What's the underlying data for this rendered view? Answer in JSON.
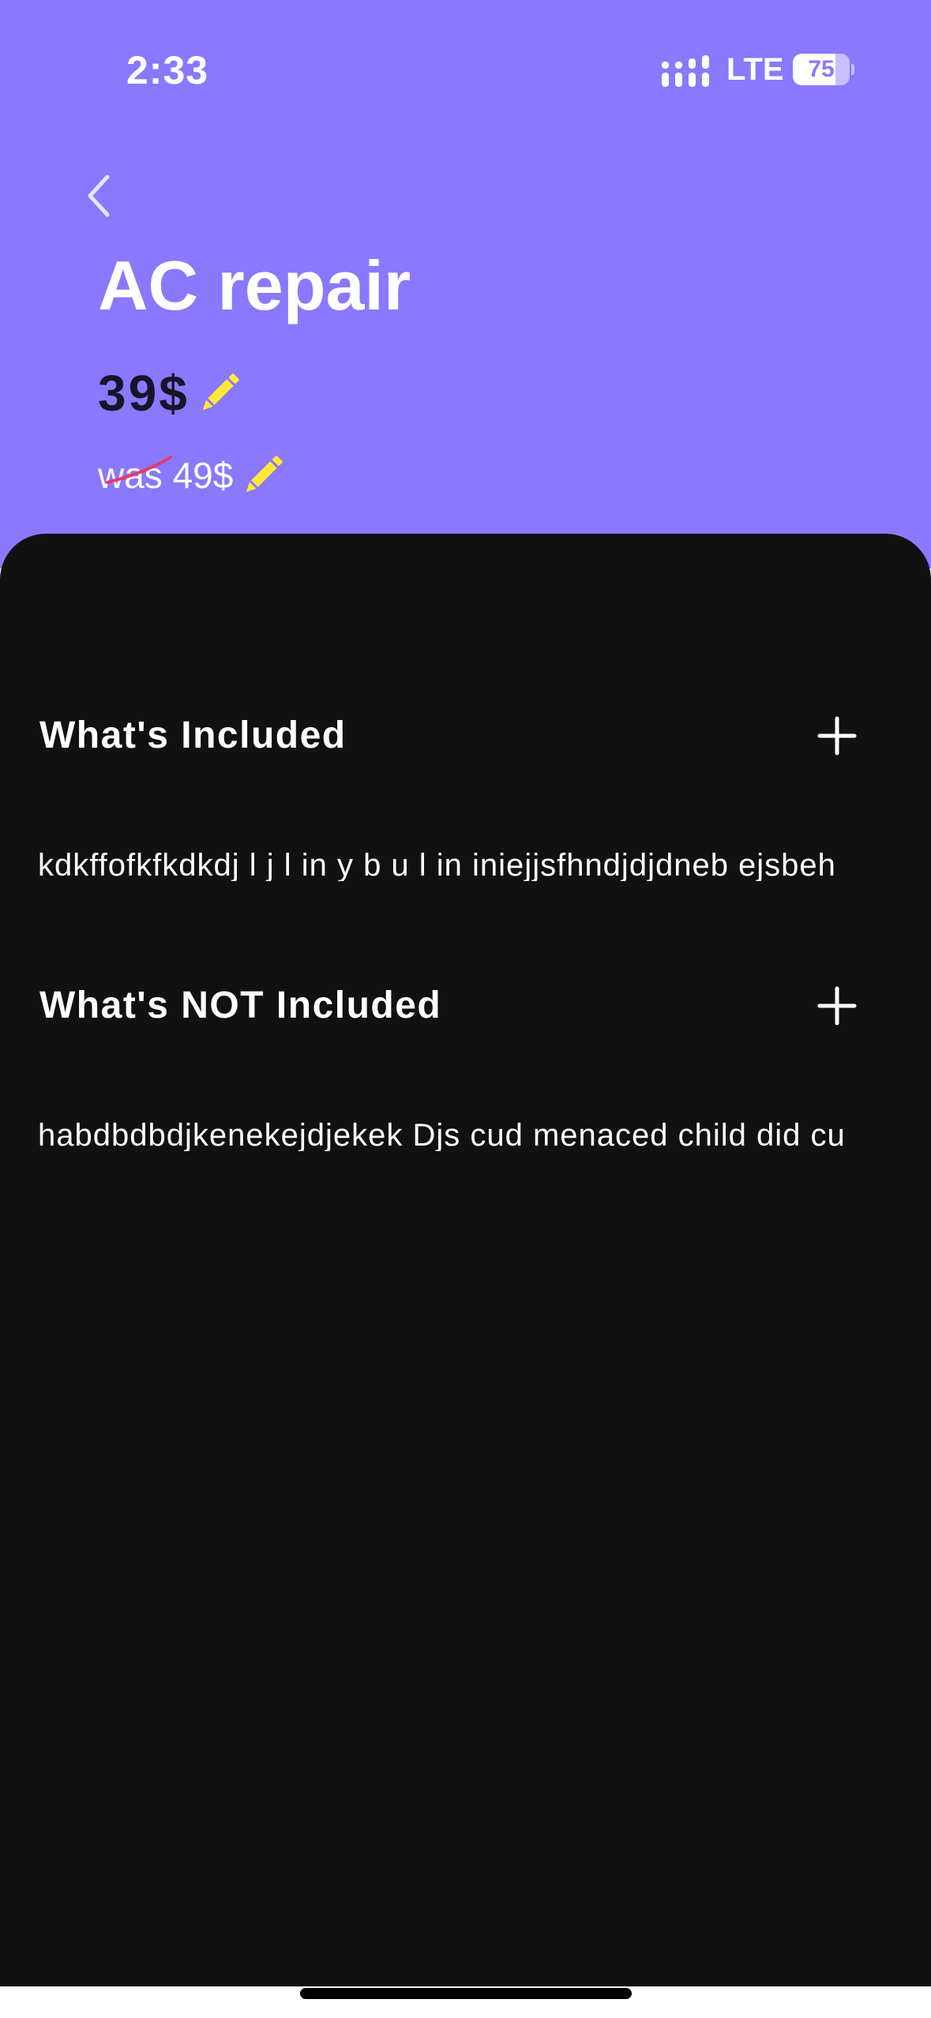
{
  "status_bar": {
    "time": "2:33",
    "network": "LTE",
    "battery_percent": "75",
    "battery_level": 0.75,
    "signal_icon": "cellular-signal-icon",
    "battery_icon": "battery-icon"
  },
  "header": {
    "back_icon": "chevron-left-icon",
    "title": "AC repair",
    "price": "39$",
    "old_price": "was 49$",
    "edit_icon": "pencil-icon",
    "background_color": "#8A78FD",
    "edit_icon_color": "#FFE838",
    "strike_color": "#E5386F"
  },
  "sections": [
    {
      "heading": "What's Included",
      "body": "kdkffofkfkdkdj l j l in y b u l in iniejjsfhndjdjdneb ejsbeh",
      "action_icon": "plus-icon"
    },
    {
      "heading": "What's NOT Included",
      "body": "habdbdbdjkenekejdjekek Djs cud menaced child did cu",
      "action_icon": "plus-icon"
    }
  ],
  "content_background": "#121112"
}
